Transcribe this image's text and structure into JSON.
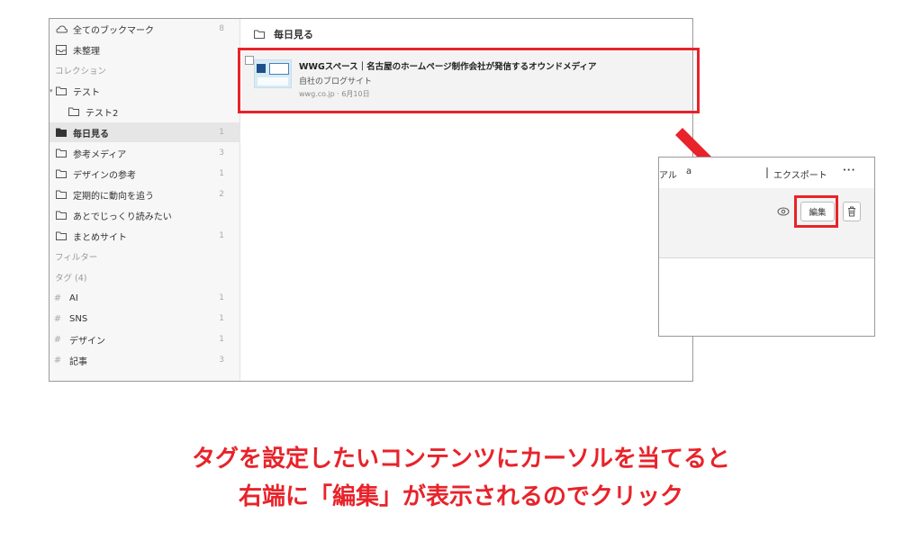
{
  "sidebar": {
    "all_bookmarks": {
      "label": "全てのブックマーク",
      "count": "8"
    },
    "unsorted": {
      "label": "未整理"
    },
    "collections_heading": "コレクション",
    "collections": [
      {
        "label": "テスト",
        "count": ""
      },
      {
        "label": "テスト2",
        "count": ""
      },
      {
        "label": "毎日見る",
        "count": "1"
      },
      {
        "label": "参考メディア",
        "count": "3"
      },
      {
        "label": "デザインの参考",
        "count": "1"
      },
      {
        "label": "定期的に動向を追う",
        "count": "2"
      },
      {
        "label": "あとでじっくり読みたい",
        "count": ""
      },
      {
        "label": "まとめサイト",
        "count": "1"
      }
    ],
    "filters_heading": "フィルター",
    "tags_heading": "タグ (4)",
    "tags": [
      {
        "label": "AI",
        "count": "1"
      },
      {
        "label": "SNS",
        "count": "1"
      },
      {
        "label": "デザイン",
        "count": "1"
      },
      {
        "label": "記事",
        "count": "3"
      }
    ]
  },
  "content": {
    "title": "毎日見る",
    "card": {
      "title": "WWGスペース｜名古屋のホームページ制作会社が発信するオウンドメディア",
      "description": "自社のブログサイト",
      "meta": "wwg.co.jp · 6月10日"
    }
  },
  "inset": {
    "frag1": "アル",
    "frag2": "a",
    "export_label": "エクスポート",
    "more_label": "···",
    "edit_label": "編集"
  },
  "caption": {
    "line1": "タグを設定したいコンテンツにカーソルを当てると",
    "line2": "右端に「編集」が表示されるのでクリック"
  },
  "colors": {
    "highlight": "#e8232a"
  }
}
